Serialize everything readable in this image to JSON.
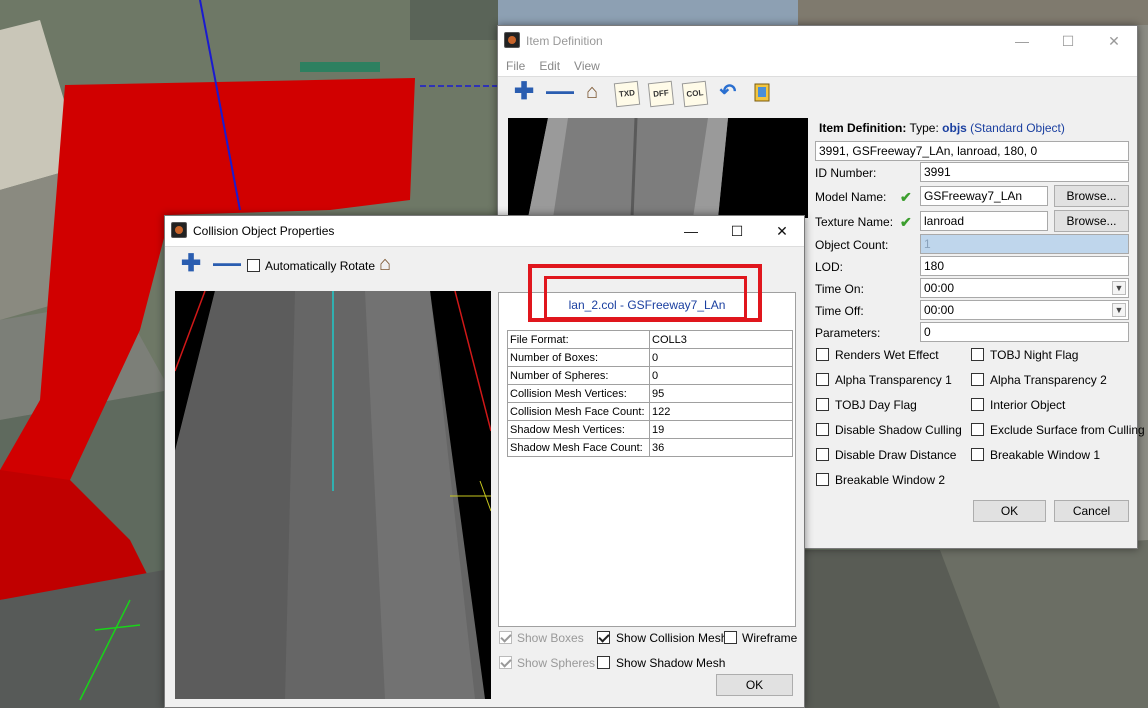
{
  "item_def": {
    "title": "Item Definition",
    "menu": [
      "File",
      "Edit",
      "View"
    ],
    "toolbar": {
      "txd": "TXD",
      "dff": "DFF",
      "col": "COL"
    },
    "heading_label": "Item Definition:",
    "type_label": "Type:",
    "type_value": "objs",
    "type_desc": "(Standard Object)",
    "raw_line": "3991, GSFreeway7_LAn, lanroad, 180, 0",
    "fields": {
      "id_label": "ID Number:",
      "id_value": "3991",
      "model_label": "Model Name:",
      "model_value": "GSFreeway7_LAn",
      "texture_label": "Texture Name:",
      "texture_value": "lanroad",
      "count_label": "Object Count:",
      "count_value": "1",
      "lod_label": "LOD:",
      "lod_value": "180",
      "timeon_label": "Time On:",
      "timeon_value": "00:00",
      "timeoff_label": "Time Off:",
      "timeoff_value": "00:00",
      "params_label": "Parameters:",
      "params_value": "0"
    },
    "browse": "Browse...",
    "flags": [
      {
        "label": "Renders Wet Effect",
        "checked": false
      },
      {
        "label": "TOBJ Night Flag",
        "checked": false
      },
      {
        "label": "Alpha Transparency 1",
        "checked": false
      },
      {
        "label": "Alpha Transparency 2",
        "checked": false
      },
      {
        "label": "TOBJ Day Flag",
        "checked": false
      },
      {
        "label": "Interior Object",
        "checked": false
      },
      {
        "label": "Disable Shadow Culling",
        "checked": false
      },
      {
        "label": "Exclude Surface from Culling",
        "checked": false
      },
      {
        "label": "Disable Draw Distance",
        "checked": false
      },
      {
        "label": "Breakable Window 1",
        "checked": false
      },
      {
        "label": "Breakable Window 2",
        "checked": false
      }
    ],
    "ok": "OK",
    "cancel": "Cancel"
  },
  "collision": {
    "title": "Collision Object Properties",
    "auto_rotate": "Automatically Rotate",
    "info_title": "lan_2.col - GSFreeway7_LAn",
    "rows": [
      {
        "k": "File Format:",
        "v": "COLL3"
      },
      {
        "k": "Number of Boxes:",
        "v": "0"
      },
      {
        "k": "Number of Spheres:",
        "v": "0"
      },
      {
        "k": "Collision Mesh Vertices:",
        "v": "95"
      },
      {
        "k": "Collision Mesh Face Count:",
        "v": "122"
      },
      {
        "k": "Shadow Mesh Vertices:",
        "v": "19"
      },
      {
        "k": "Shadow Mesh Face Count:",
        "v": "36"
      }
    ],
    "opts": {
      "show_boxes": "Show Boxes",
      "show_collision": "Show Collision Mesh",
      "wireframe": "Wireframe",
      "show_spheres": "Show Spheres",
      "show_shadow": "Show Shadow Mesh"
    },
    "ok": "OK"
  },
  "colors": {
    "highlight": "#e0161d",
    "link": "#1a3fa0",
    "scene_red": "#d10000"
  }
}
